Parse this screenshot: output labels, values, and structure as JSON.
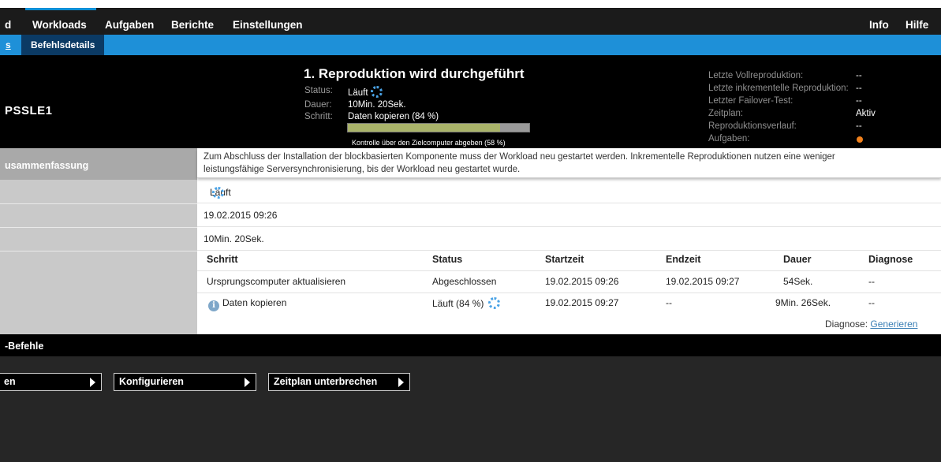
{
  "topnav": {
    "items": [
      "d",
      "Workloads",
      "Aufgaben",
      "Berichte",
      "Einstellungen"
    ],
    "right": [
      "Info",
      "Hilfe"
    ]
  },
  "subnav": {
    "left_link": "s",
    "active_tab": "Befehlsdetails"
  },
  "header": {
    "hostname": "PSSLE1",
    "title": "1. Reproduktion wird durchgeführt",
    "status_key": "Status:",
    "status_val": "Läuft",
    "dauer_key": "Dauer:",
    "dauer_val": "10Min. 20Sek.",
    "schritt_key": "Schritt:",
    "schritt_val": "Daten kopieren (84 %)",
    "progress_percent": 84,
    "progress_label": "Kontrolle über den Zielcomputer abgeben (58 %)",
    "right_info": [
      {
        "key": "Letzte Vollreproduktion:",
        "val": "--"
      },
      {
        "key": "Letzte inkrementelle Reproduktion:",
        "val": "--"
      },
      {
        "key": "Letzter Failover-Test:",
        "val": "--"
      },
      {
        "key": "Zeitplan:",
        "val": "Aktiv"
      },
      {
        "key": "Reproduktionsverlauf:",
        "val": "--"
      },
      {
        "key": "Aufgaben:",
        "val": ""
      }
    ]
  },
  "left": {
    "section": "usammenfassung"
  },
  "banner": {
    "line1": "Zum Abschluss der Installation der blockbasierten Komponente muss der Workload neu gestartet werden. Inkrementelle Reproduktionen nutzen eine weniger",
    "line2": "leistungsfähige Serversynchronisierung, bis der Workload neu gestartet wurde."
  },
  "summary": {
    "status": "Läuft",
    "start": "19.02.2015 09:26",
    "duration": "10Min. 20Sek."
  },
  "steps": {
    "headers": [
      "Schritt",
      "Status",
      "Startzeit",
      "Endzeit",
      "Dauer",
      "Diagnose"
    ],
    "rows": [
      [
        "Ursprungscomputer aktualisieren",
        "Abgeschlossen",
        "19.02.2015 09:26",
        "19.02.2015 09:27",
        "54Sek.",
        "--"
      ],
      [
        "Daten kopieren",
        "Läuft (84 %)",
        "19.02.2015 09:27",
        "--",
        "9Min. 26Sek.",
        "--"
      ]
    ],
    "diag_label": "Diagnose:",
    "diag_link": "Generieren"
  },
  "commands": {
    "title": "-Befehle",
    "buttons": [
      "en",
      "Konfigurieren",
      "Zeitplan unterbrechen"
    ]
  },
  "colors": {
    "nav_bg": "#1b1b1b",
    "subnav_bg": "#1e90d8",
    "active_tab_bg": "#0b3a64",
    "progress_fill": "#a9b36a",
    "link": "#3a7fb5"
  }
}
